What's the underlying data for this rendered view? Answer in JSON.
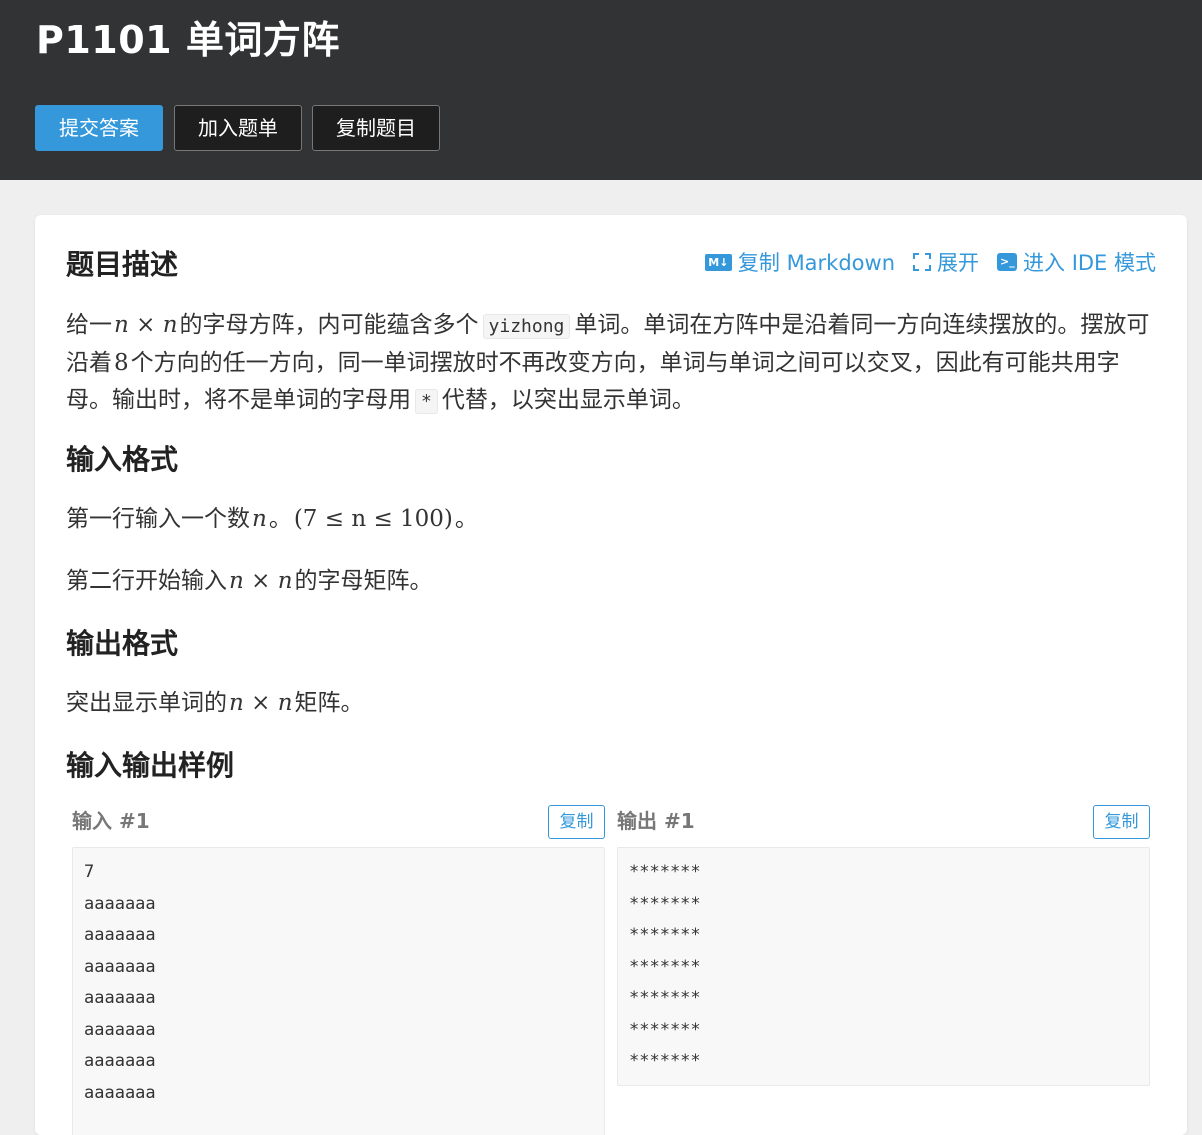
{
  "header": {
    "title": "P1101 单词方阵",
    "buttons": {
      "submit": "提交答案",
      "add_list": "加入题单",
      "copy_problem": "复制题目"
    }
  },
  "toolbar": {
    "copy_markdown": "复制 Markdown",
    "expand": "展开",
    "ide_mode": "进入 IDE 模式",
    "md_icon_text": "M↓",
    "ide_icon_text": ">_"
  },
  "description": {
    "heading": "题目描述",
    "p1": "给一",
    "m1": "n × n",
    "p2": "的字母方阵，内可能蕴含多个",
    "code1": "yizhong",
    "p3": "单词。单词在方阵中是沿着同一方向连续摆放的。摆放可沿着",
    "m2": "8",
    "p4": "个方向的任一方向，同一单词摆放时不再改变方向，单词与单词之间可以交叉，因此有可能共用字母。输出时，将不是单词的字母用",
    "code2": "*",
    "p5": "代替，以突出显示单词。"
  },
  "input_format": {
    "heading": "输入格式",
    "line1_a": "第一行输入一个数",
    "line1_m": "n",
    "line1_b": "。",
    "line1_m2": "(7 ≤ n ≤ 100)",
    "line1_c": "。",
    "line2_a": "第二行开始输入",
    "line2_m": "n × n",
    "line2_b": "的字母矩阵。"
  },
  "output_format": {
    "heading": "输出格式",
    "line_a": "突出显示单词的",
    "line_m": "n × n",
    "line_b": "矩阵。"
  },
  "samples": {
    "heading": "输入输出样例",
    "input_label": "输入 #1",
    "output_label": "输出 #1",
    "copy_label": "复制",
    "input_text": "7\naaaaaaa\naaaaaaa\naaaaaaa\naaaaaaa\naaaaaaa\naaaaaaa\naaaaaaa",
    "output_text": "*******\n*******\n*******\n*******\n*******\n*******\n*******"
  },
  "colors": {
    "header_bg": "#323334",
    "primary": "#3498db",
    "page_bg": "#efefef"
  }
}
